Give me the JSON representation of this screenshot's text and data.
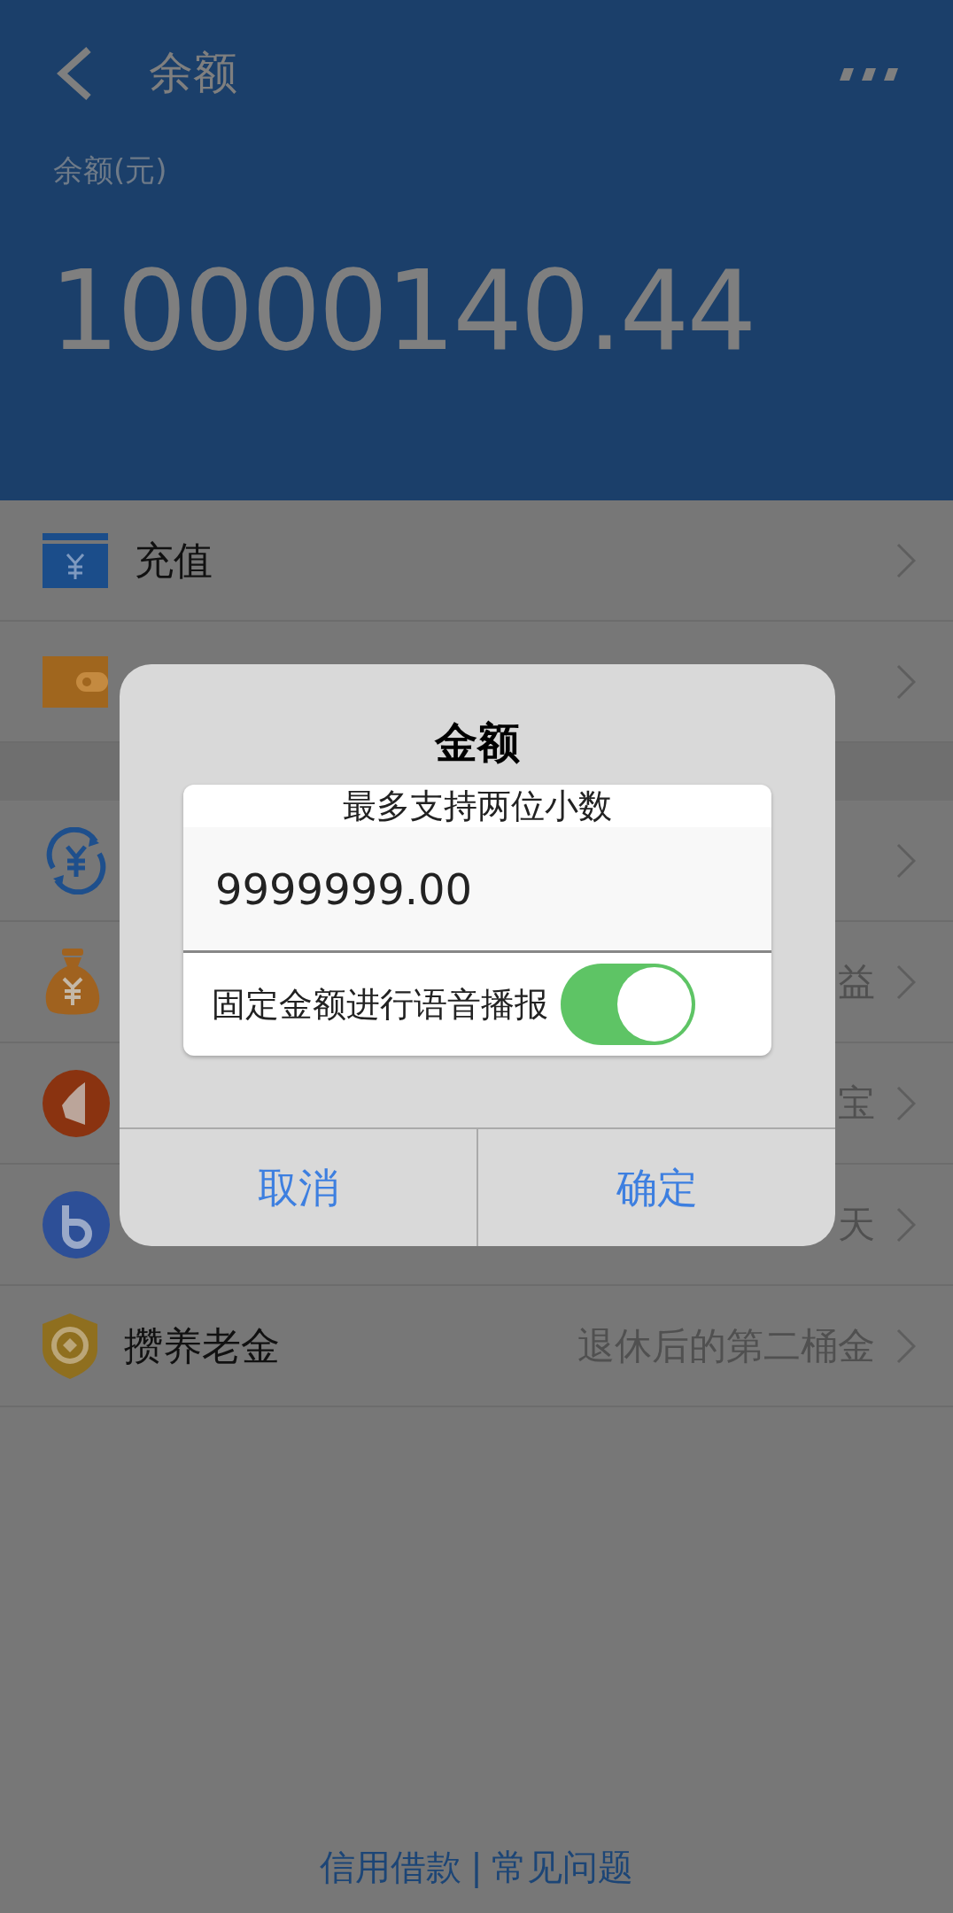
{
  "header": {
    "title": "余额",
    "balance_label": "余额(元)",
    "balance": "10000140.44"
  },
  "sections": [
    [
      {
        "kind": "row",
        "label": "充值"
      },
      {
        "kind": "row"
      }
    ],
    [
      {
        "kind": "row"
      },
      {
        "kind": "row",
        "detail": "益"
      },
      {
        "kind": "row",
        "detail": "宝"
      },
      {
        "kind": "row",
        "detail": "天"
      },
      {
        "kind": "row",
        "label": "攒养老金",
        "detail": "退休后的第二桶金"
      }
    ]
  ],
  "dialog": {
    "title": "金额",
    "hint": "最多支持两位小数",
    "value": "9999999.00",
    "toggle": {
      "label": "固定金额进行语音播报",
      "on": true
    },
    "buttons": [
      "取消",
      "确定"
    ]
  },
  "footer": {
    "links": [
      "信用借款",
      "常见问题"
    ],
    "separator": "|"
  }
}
